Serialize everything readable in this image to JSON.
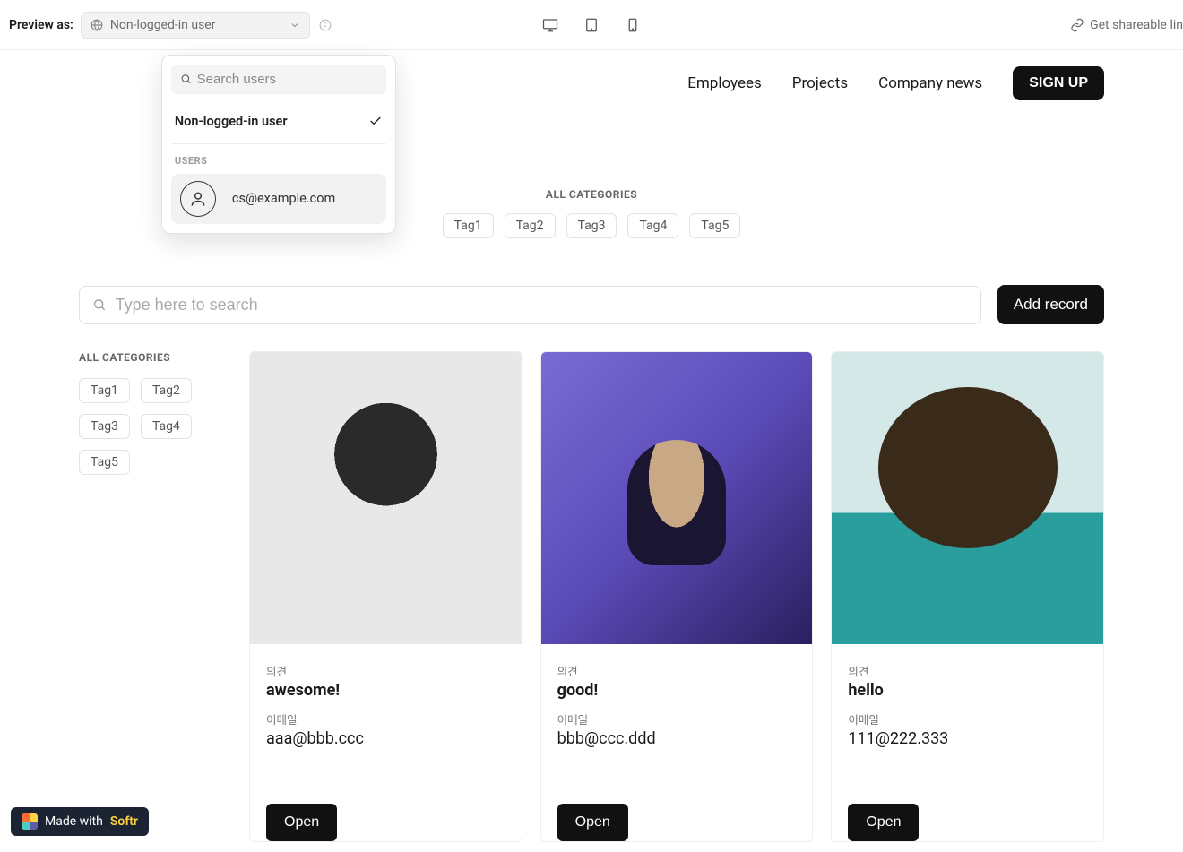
{
  "preview_bar": {
    "label": "Preview as:",
    "selected": "Non-logged-in user",
    "share_label": "Get shareable lin"
  },
  "dropdown": {
    "search_placeholder": "Search users",
    "option_selected": "Non-logged-in user",
    "users_header": "USERS",
    "users": [
      {
        "email": "cs@example.com"
      }
    ]
  },
  "header": {
    "nav": {
      "employees": "Employees",
      "projects": "Projects",
      "company_news": "Company news"
    },
    "signup": "SIGN UP"
  },
  "center_categories": {
    "title": "ALL CATEGORIES",
    "tags": [
      "Tag1",
      "Tag2",
      "Tag3",
      "Tag4",
      "Tag5"
    ]
  },
  "search": {
    "placeholder": "Type here to search",
    "add_record": "Add record"
  },
  "sidebar": {
    "title": "ALL CATEGORIES",
    "tags": [
      "Tag1",
      "Tag2",
      "Tag3",
      "Tag4",
      "Tag5"
    ]
  },
  "cards": [
    {
      "opinion_label": "의견",
      "opinion_value": "awesome!",
      "email_label": "이메일",
      "email_value": "aaa@bbb.ccc",
      "open": "Open"
    },
    {
      "opinion_label": "의견",
      "opinion_value": "good!",
      "email_label": "이메일",
      "email_value": "bbb@ccc.ddd",
      "open": "Open"
    },
    {
      "opinion_label": "의견",
      "opinion_value": "hello",
      "email_label": "이메일",
      "email_value": "111@222.333",
      "open": "Open"
    }
  ],
  "softr": {
    "prefix": "Made with ",
    "brand": "Softr"
  }
}
